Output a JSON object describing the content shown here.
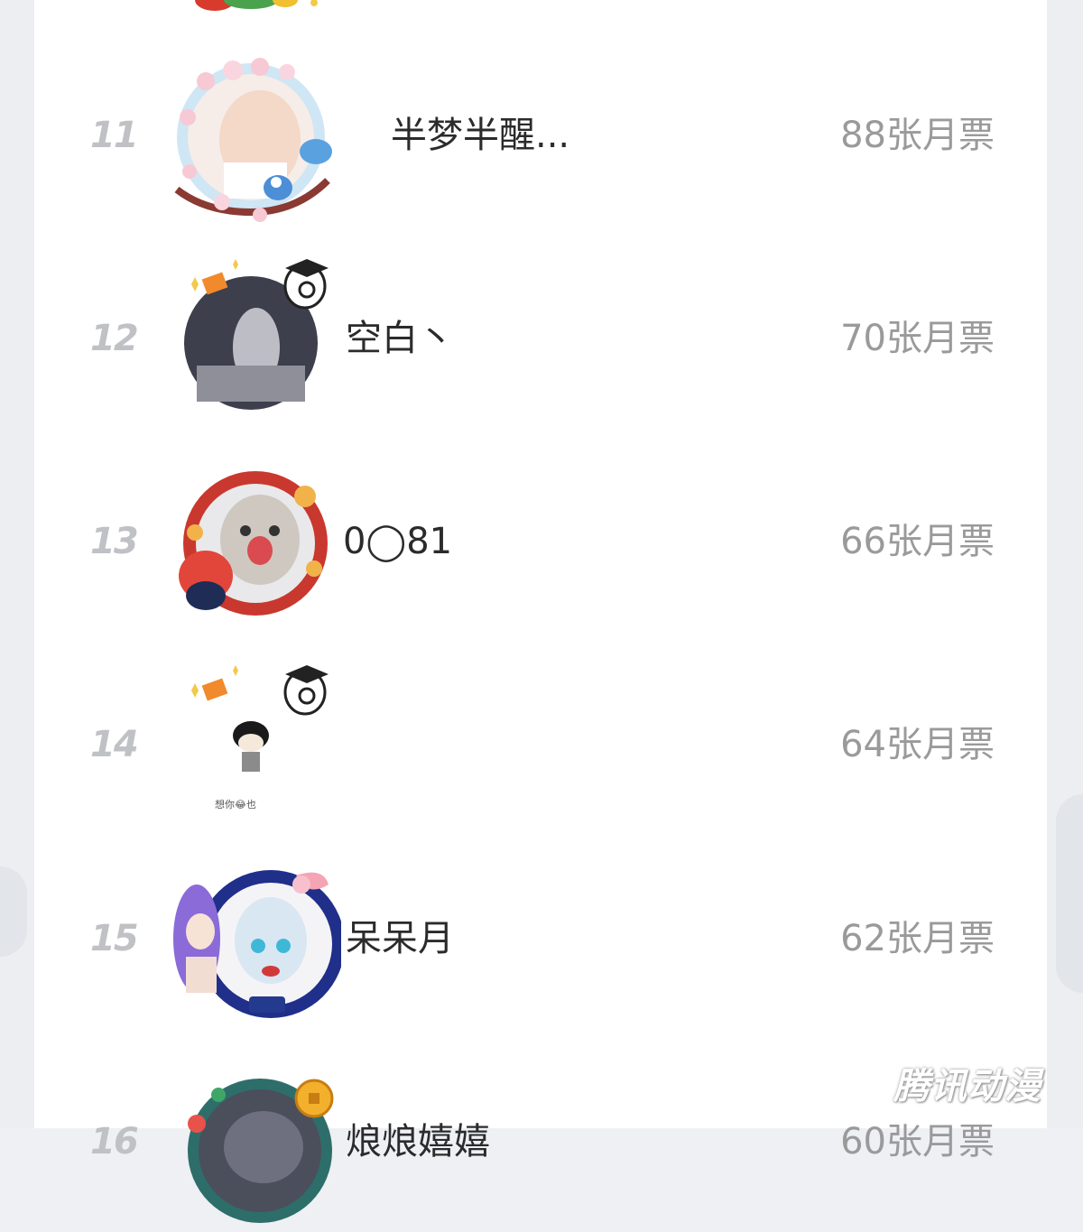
{
  "ranking": {
    "rows": [
      {
        "rank": "11",
        "name": "半梦半醒...",
        "votes": "88张月票",
        "avatar": "user-photo-with-flower-frame"
      },
      {
        "rank": "12",
        "name": "空白丶",
        "votes": "70张月票",
        "avatar": "dim-photo-with-scholar-badge"
      },
      {
        "rank": "13",
        "name": "0◯81",
        "votes": "66张月票",
        "avatar": "cat-photo-with-lion-dance-frame"
      },
      {
        "rank": "14",
        "name": "",
        "votes": "64张月票",
        "avatar": "meme-sticker-with-scholar-badge",
        "avatar_caption": "想你😂也"
      },
      {
        "rank": "15",
        "name": "呆呆月",
        "votes": "62张月票",
        "avatar": "anime-girls-with-bow-frame"
      },
      {
        "rank": "16",
        "name": "烺烺嬉嬉",
        "votes": "60张月票",
        "avatar": "dark-photo-with-coin-frame"
      }
    ]
  },
  "watermark": "腾讯动漫",
  "colors": {
    "rank": "#bfc1c5",
    "name": "#2b2b2b",
    "votes": "#9a9a9a",
    "panel": "#ffffff",
    "background": "#eef0f4"
  }
}
